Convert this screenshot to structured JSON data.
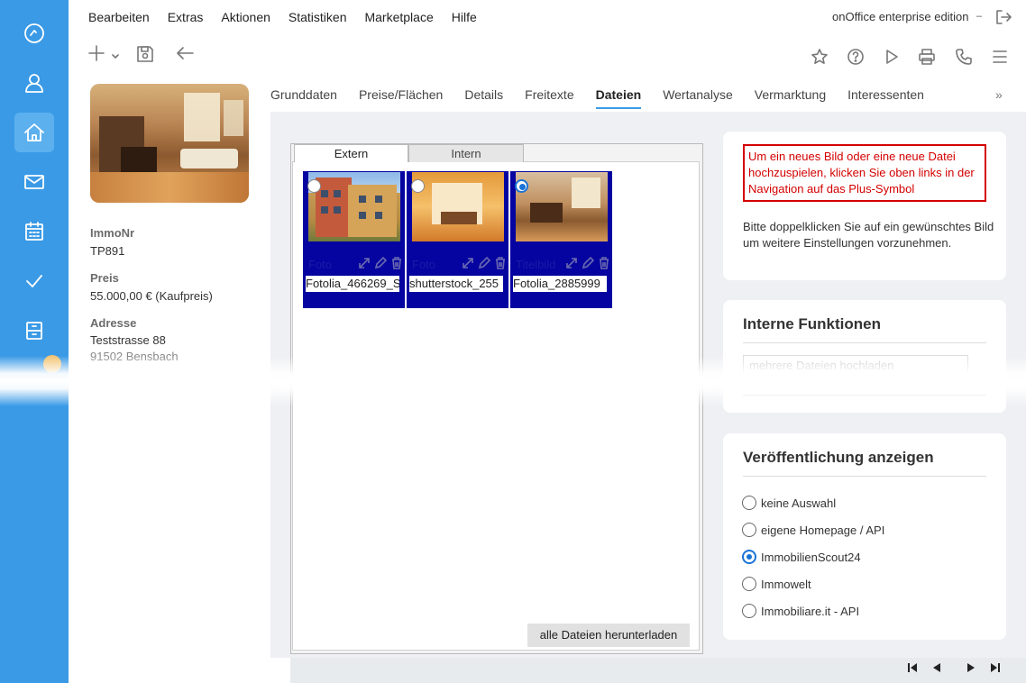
{
  "menu": {
    "items": [
      "Bearbeiten",
      "Extras",
      "Aktionen",
      "Statistiken",
      "Marketplace",
      "Hilfe"
    ],
    "edition": "onOffice enterprise edition"
  },
  "rail": {
    "icons": [
      "dashboard-icon",
      "contact-icon",
      "property-icon",
      "mail-icon",
      "calendar-icon",
      "tasks-icon",
      "files-icon"
    ],
    "active": "property-icon",
    "accent": "#3a9ae6"
  },
  "toolbar": {
    "left_icons": [
      "add-icon",
      "save-icon",
      "back-icon"
    ],
    "right_icons": [
      "star-icon",
      "help-icon",
      "play-icon",
      "print-icon",
      "phone-icon",
      "menu-icon"
    ]
  },
  "property": {
    "immonr_label": "ImmoNr",
    "immonr_value": "TP891",
    "preis_label": "Preis",
    "preis_value": "55.000,00 € (Kaufpreis)",
    "adresse_label": "Adresse",
    "adresse_street": "Teststrasse 88",
    "adresse_city": "91502 Bensbach"
  },
  "tabs": {
    "items": [
      "Grunddaten",
      "Preise/Flächen",
      "Details",
      "Freitexte",
      "Dateien",
      "Wertanalyse",
      "Vermarktung",
      "Interessenten"
    ],
    "active": "Dateien",
    "more": "»"
  },
  "files": {
    "subtabs": [
      "Extern",
      "Intern"
    ],
    "active_subtab": "Extern",
    "tiles": [
      {
        "type": "Foto",
        "filename": "Fotolia_466269_S",
        "selected": false
      },
      {
        "type": "Foto",
        "filename": "shutterstock_255",
        "selected": false
      },
      {
        "type": "Titelbild",
        "filename": "Fotolia_2885999",
        "selected": true
      }
    ],
    "download_all": "alle Dateien herunterladen"
  },
  "notice": {
    "text": "Um ein neues Bild oder eine neue Datei hochzuspielen, klicken Sie oben links in der Navigation auf das Plus-Symbol",
    "hint": "Bitte doppelklicken Sie auf ein gewünschtes Bild um weitere Einstellungen vorzunehmen."
  },
  "internal": {
    "title": "Interne Funktionen",
    "button": "mehrere Dateien hochladen"
  },
  "publication": {
    "title": "Veröffentlichung anzeigen",
    "options": [
      "keine Auswahl",
      "eigene Homepage / API",
      "ImmobilienScout24",
      "Immowelt",
      "Immobiliare.it - API"
    ],
    "selected": "ImmobilienScout24"
  },
  "pager": {
    "icons": [
      "first-page-icon",
      "prev-page-icon",
      "next-page-icon",
      "last-page-icon"
    ]
  }
}
